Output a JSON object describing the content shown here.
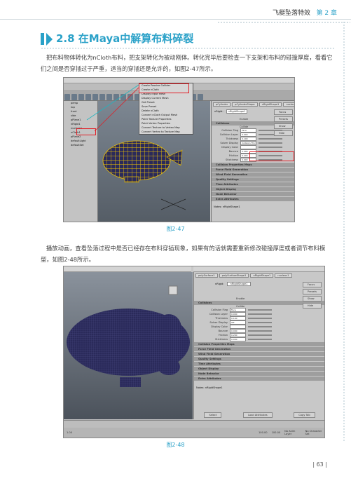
{
  "header": {
    "book_title": "飞艇坠落特效",
    "chapter": "第 2 章"
  },
  "section": {
    "title": "2.8  在Maya中解算布料碎裂"
  },
  "paragraphs": [
    "把布料物体转化为nCloth布料，把支架转化为被动刚体。转化完毕后要检查一下支架和布料的碰撞厚度，看看它们之间是否穿插过于严重，适当的穿插还是允许的，如图2-47所示。",
    "播放动画，查看坠落过程中是否已经存在布料穿插现象，如果有的话就需要重新修改碰撞厚度或者调节布料模型，如图2-48所示。"
  ],
  "figures": [
    {
      "caption": "图2-47"
    },
    {
      "caption": "图2-48"
    }
  ],
  "page_number": "63",
  "colors": {
    "accent": "#2aa1c8",
    "highlight_box": "#e21e26",
    "mesh": "#2a2a5a",
    "grid_lines": "#f2c400"
  },
  "screenshot1": {
    "menu": [
      "File",
      "Edit",
      "Modify",
      "Create",
      "Display",
      "Window",
      "Assets",
      "Select",
      "Mesh",
      "Edit Mesh",
      "Proxy",
      "Normals",
      "Color",
      "nMesh",
      "nConstraint",
      "nCache",
      "Fields",
      "Solvers",
      "Effects",
      "Assets",
      "Muscle",
      "Help"
    ],
    "outliner_items": [
      "persp",
      "top",
      "front",
      "side",
      "pPlane1",
      "nRigid1",
      "nucleus1",
      "nCloth1",
      "pPlane2",
      "defaultLight",
      "defaultSet"
    ],
    "popup_menu": [
      "Create Passive Collider",
      "Create nCloth",
      "Display Input Mesh",
      "Display Current Mesh",
      "Get Preset",
      "Save Preset",
      "Delete nCloth",
      "Convert nCloth Output Mesh",
      "Paint Texture Properties",
      "Paint Vertex Properties",
      "Convert Texture to Vertex Map",
      "Convert Vertex to Texture Map"
    ],
    "attr_tabs": [
      "pCylinder",
      "pCylinderShape",
      "nRigidShape1",
      "nucleus1"
    ],
    "attr_field_label": "nRigid:",
    "attr_field_value": "nRigidShape1",
    "attr_buttons": [
      "Focus",
      "Presets",
      "Show",
      "Hide"
    ],
    "attr_enable_label": "Enable",
    "collisions_header": "Collisions",
    "collide_label": "Collide",
    "collision_rows": [
      {
        "label": "Collision Flag",
        "value": "Face"
      },
      {
        "label": "Collision Layer",
        "value": "0.000"
      },
      {
        "label": "Thickness",
        "value": "0.100"
      },
      {
        "label": "Solver Display",
        "value": "Collision Thickness"
      },
      {
        "label": "Display Color",
        "value": ""
      },
      {
        "label": "Bounce",
        "value": "0.000"
      },
      {
        "label": "Friction",
        "value": "0.200"
      },
      {
        "label": "Stickiness",
        "value": "0.000"
      }
    ],
    "sections": [
      "Collision Properties Maps",
      "Force Field Generation",
      "Wind Field Generation",
      "Quality Settings",
      "Time Attributes",
      "Object Display",
      "Node Behavior",
      "Extra Attributes"
    ],
    "notes_label": "Notes:  nRigidShape1"
  },
  "screenshot2": {
    "menu": [
      "View",
      "Shading",
      "Lighting",
      "Show",
      "Renderer",
      "Panels"
    ],
    "attr_menu": [
      "List",
      "Selected",
      "Focus",
      "Attributes",
      "Show",
      "Help"
    ],
    "attr_tabs": [
      "polySurface1",
      "polySurfaceShape1",
      "nRigidShape1",
      "nucleus1"
    ],
    "attr_field_label": "nRigid:",
    "attr_field_value": "nRigidShape1",
    "attr_buttons": [
      "Focus",
      "Presets",
      "Show",
      "Hide"
    ],
    "attr_enable_label": "Enable",
    "collisions_header": "Collisions",
    "collide_label": "Collide",
    "collision_rows": [
      {
        "label": "Collision Flag",
        "value": "Face"
      },
      {
        "label": "Collision Layer",
        "value": "0.000"
      },
      {
        "label": "Thickness",
        "value": "0.100"
      },
      {
        "label": "Solver Display",
        "value": "Off"
      },
      {
        "label": "Display Color",
        "value": ""
      },
      {
        "label": "Bounce",
        "value": "0.000"
      },
      {
        "label": "Friction",
        "value": "0.200"
      },
      {
        "label": "Stickiness",
        "value": "0.000"
      }
    ],
    "sections": [
      "Collision Properties Maps",
      "Force Field Generation",
      "Wind Field Generation",
      "Quality Settings",
      "Time Attributes",
      "Object Display",
      "Node Behavior",
      "Extra Attributes"
    ],
    "notes_label": "Notes:  nRigidShape1",
    "bottom_buttons": [
      "Select",
      "Load Attributes",
      "Copy Tab"
    ],
    "timeline_ticks": [
      "70",
      "72",
      "74",
      "76",
      "78",
      "80",
      "82",
      "84",
      "86",
      "88",
      "90",
      "92",
      "94",
      "96",
      "98",
      "100",
      "102",
      "104",
      "106"
    ],
    "frame_current": "100.00",
    "range_start": "1.00",
    "range_end": "100.00",
    "layer_label": "No Anim Layer",
    "char_label": "No Character Set"
  }
}
